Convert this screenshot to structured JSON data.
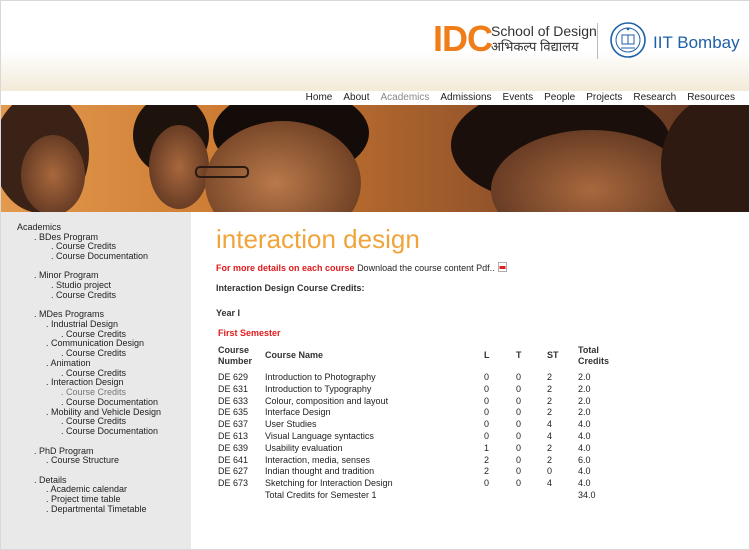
{
  "header": {
    "logo_idc": "IDC",
    "logo_school": "School of Design",
    "logo_hindi": "अभिकल्प विद्यालय",
    "logo_iitb": "IIT Bombay"
  },
  "nav": {
    "items": [
      "Home",
      "About",
      "Academics",
      "Admissions",
      "Events",
      "People",
      "Projects",
      "Research",
      "Resources"
    ],
    "active": "Academics"
  },
  "sidebar": {
    "items": [
      {
        "label": "Academics",
        "dim": false
      },
      {
        "label": ". BDes Program",
        "dim": false
      },
      {
        "label": ". Course Credits",
        "dim": false
      },
      {
        "label": ". Course Documentation",
        "dim": false
      },
      {
        "label": ". Minor Program",
        "dim": false
      },
      {
        "label": ". Studio project",
        "dim": false
      },
      {
        "label": ". Course Credits",
        "dim": false
      },
      {
        "label": ". MDes Programs",
        "dim": false
      },
      {
        "label": ". Industrial Design",
        "dim": false
      },
      {
        "label": ". Course Credits",
        "dim": false
      },
      {
        "label": ". Communication Design",
        "dim": false
      },
      {
        "label": ". Course Credits",
        "dim": false
      },
      {
        "label": ". Animation",
        "dim": false
      },
      {
        "label": ". Course Credits",
        "dim": false
      },
      {
        "label": ". Interaction Design",
        "dim": false
      },
      {
        "label": ". Course Credits",
        "dim": true
      },
      {
        "label": ". Course Documentation",
        "dim": false
      },
      {
        "label": ". Mobility and Vehicle Design",
        "dim": false
      },
      {
        "label": ". Course Credits",
        "dim": false
      },
      {
        "label": ". Course Documentation",
        "dim": false
      },
      {
        "label": ". PhD Program",
        "dim": false
      },
      {
        "label": ". Course Structure",
        "dim": false
      },
      {
        "label": ". Details",
        "dim": false
      },
      {
        "label": ". Academic calendar",
        "dim": false
      },
      {
        "label": ". Project time table",
        "dim": false
      },
      {
        "label": ". Departmental Timetable",
        "dim": false
      }
    ]
  },
  "content": {
    "title": "interaction design",
    "more_bold": "For more details on each course",
    "more_link": "Download the course content Pdf..",
    "credits_heading": "Interaction Design Course Credits:",
    "year": "Year I",
    "semester": "First Semester",
    "table": {
      "headers": {
        "number": [
          "Course",
          "Number"
        ],
        "name": "Course Name",
        "l": "L",
        "t": "T",
        "st": "ST",
        "credits": [
          "Total",
          "Credits"
        ]
      },
      "rows": [
        {
          "number": "DE 629",
          "name": "Introduction to Photography",
          "l": "0",
          "t": "0",
          "st": "2",
          "credits": "2.0"
        },
        {
          "number": "DE 631",
          "name": "Introduction to Typography",
          "l": "0",
          "t": "0",
          "st": "2",
          "credits": "2.0"
        },
        {
          "number": "DE 633",
          "name": "Colour, composition and layout",
          "l": "0",
          "t": "0",
          "st": "2",
          "credits": "2.0"
        },
        {
          "number": "DE 635",
          "name": "Interface Design",
          "l": "0",
          "t": "0",
          "st": "2",
          "credits": "2.0"
        },
        {
          "number": "DE 637",
          "name": "User Studies",
          "l": "0",
          "t": "0",
          "st": "4",
          "credits": "4.0"
        },
        {
          "number": "DE 613",
          "name": "Visual Language syntactics",
          "l": "0",
          "t": "0",
          "st": "4",
          "credits": "4.0"
        },
        {
          "number": "DE 639",
          "name": "Usability evaluation",
          "l": "1",
          "t": "0",
          "st": "2",
          "credits": "4.0"
        },
        {
          "number": "DE 641",
          "name": "Interaction, media, senses",
          "l": "2",
          "t": "0",
          "st": "2",
          "credits": "6.0"
        },
        {
          "number": "DE 627",
          "name": "Indian thought and tradition",
          "l": "2",
          "t": "0",
          "st": "0",
          "credits": "4.0"
        },
        {
          "number": "DE 673",
          "name": "Sketching for Interaction Design",
          "l": "0",
          "t": "0",
          "st": "4",
          "credits": "4.0"
        }
      ],
      "total_label": "Total Credits for Semester 1",
      "total_value": "34.0"
    }
  },
  "colors": {
    "brand_orange": "#ef7d1a",
    "title_orange": "#f0a43a",
    "accent_red": "#e01a1a",
    "iitb_blue": "#1f5fa8",
    "sidebar_bg": "#e9e9e9"
  }
}
